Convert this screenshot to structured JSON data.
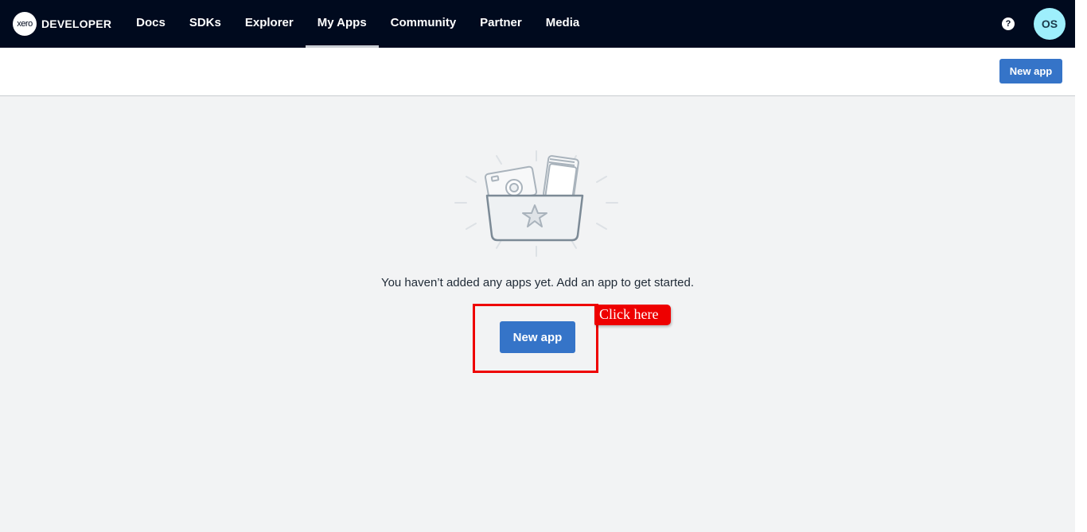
{
  "brand": {
    "logo_text": "xero",
    "title": "DEVELOPER"
  },
  "nav": {
    "items": [
      {
        "label": "Docs"
      },
      {
        "label": "SDKs"
      },
      {
        "label": "Explorer"
      },
      {
        "label": "My Apps",
        "active": true
      },
      {
        "label": "Community"
      },
      {
        "label": "Partner"
      },
      {
        "label": "Media"
      }
    ],
    "help_icon": "question-circle-icon",
    "avatar_initials": "OS"
  },
  "header": {
    "new_app_label": "New app"
  },
  "empty_state": {
    "illustration_icon": "apps-box-illustration",
    "message": "You haven’t added any apps yet. Add an app to get started.",
    "new_app_label": "New app"
  },
  "annotation": {
    "tag_text": "Click here"
  },
  "colors": {
    "nav_background": "#000a1e",
    "primary_button": "#3574c8",
    "avatar_background": "#9eeffc",
    "page_background": "#f2f3f4",
    "highlight": "#ee0000"
  }
}
